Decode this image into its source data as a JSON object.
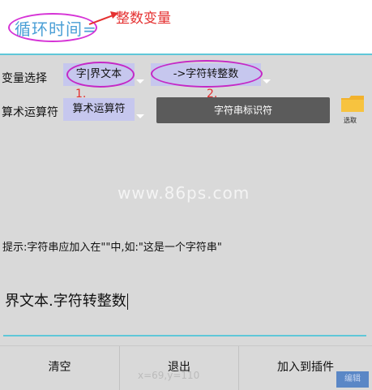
{
  "header": {
    "title": "循环时间=",
    "annotation": "整数变量"
  },
  "row1": {
    "label": "变量选择",
    "select1": "字|界文本",
    "select2": "->字符转整数"
  },
  "row2": {
    "label": "算术运算符",
    "select": "算术运算符",
    "button": "字符串标识符",
    "folder_label": "选取"
  },
  "annotations": {
    "n1": "1.",
    "n2": "2."
  },
  "watermark": "www.86ps.com",
  "hint": "提示:字符串应加入在\"\"中,如:\"这是一个字符串\"",
  "expression": "界文本.字符转整数",
  "buttons": {
    "clear": "清空",
    "exit": "退出",
    "add": "加入到插件"
  },
  "status": {
    "coords": "x=69,y=110",
    "tag": "编辑"
  },
  "colors": {
    "accent": "#5fc7d8",
    "select_bg": "#c6c7ee",
    "annotation_red": "#e53030",
    "ellipse": "#c528c5"
  }
}
